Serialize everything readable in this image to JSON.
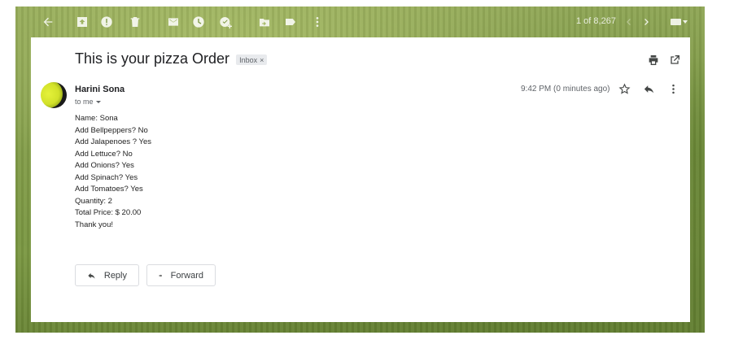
{
  "toolbar": {
    "icons": [
      "back-arrow-icon",
      "archive-icon",
      "report-spam-icon",
      "delete-icon",
      "mark-unread-icon",
      "snooze-icon",
      "add-to-tasks-icon",
      "move-to-icon",
      "labels-icon",
      "more-vert-icon"
    ],
    "counter": "1 of 8,267",
    "newer_icon": "chevron-left-icon",
    "older_icon": "chevron-right-icon",
    "input_tools_icon": "keyboard-icon"
  },
  "email": {
    "subject": "This is your pizza Order",
    "label": "Inbox",
    "label_remove": "×",
    "print_icon": "print-icon",
    "new_window_icon": "open-in-new-window-icon",
    "sender": "Harini Sona",
    "recipient": "to me",
    "time": "9:42 PM (0 minutes ago)",
    "body_lines": [
      "Name:  Sona",
      "Add Bellpeppers? No",
      "Add Jalapenoes ? Yes",
      "Add Lettuce? No",
      "Add Onions? Yes",
      "Add Spinach? Yes",
      "Add Tomatoes? Yes",
      "Quantity: 2",
      "Total Price: $ 20.00",
      "Thank you!"
    ]
  },
  "actions": {
    "reply_label": "Reply",
    "forward_label": "Forward"
  },
  "colors": {
    "text_primary": "#202124",
    "text_secondary": "#5f6368",
    "chip_bg": "#e8eaed",
    "border": "#dadce0"
  }
}
